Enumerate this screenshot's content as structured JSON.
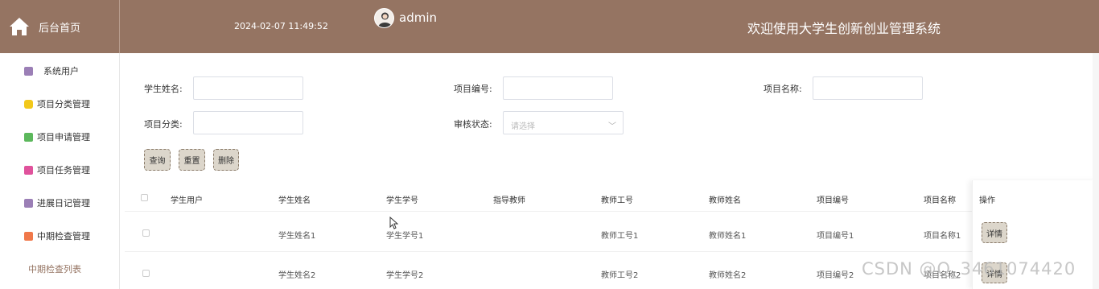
{
  "header": {
    "home_label": "后台首页",
    "datetime": "2024-02-07 11:49:52",
    "username": "admin",
    "system_title": "欢迎使用大学生创新创业管理系统"
  },
  "sidebar": {
    "items": [
      {
        "label": "系统用户",
        "icon": "user-db-icon",
        "color": "#9b7fb6"
      },
      {
        "label": "项目分类管理",
        "icon": "cube-icon",
        "color": "#f2c81b"
      },
      {
        "label": "项目申请管理",
        "icon": "message-icon",
        "color": "#5cb85c"
      },
      {
        "label": "项目任务管理",
        "icon": "task-icon",
        "color": "#e0529c"
      },
      {
        "label": "进展日记管理",
        "icon": "diary-icon",
        "color": "#9b7fb6"
      },
      {
        "label": "中期检查管理",
        "icon": "grid-icon",
        "color": "#f0784a"
      }
    ],
    "sub_item": "中期检查列表"
  },
  "search": {
    "student_name_label": "学生姓名:",
    "project_no_label": "项目编号:",
    "project_name_label": "项目名称:",
    "project_category_label": "项目分类:",
    "review_status_label": "审核状态:",
    "review_status_placeholder": "请选择"
  },
  "buttons": {
    "query": "查询",
    "reset": "重置",
    "delete": "删除"
  },
  "table": {
    "headers": [
      "学生用户",
      "学生姓名",
      "学生学号",
      "指导教师",
      "教师工号",
      "教师姓名",
      "项目编号",
      "项目名称",
      "操作"
    ],
    "rows": [
      {
        "student_user": "",
        "student_name": "学生姓名1",
        "student_no": "学生学号1",
        "advisor": "",
        "teacher_no": "教师工号1",
        "teacher_name": "教师姓名1",
        "project_no": "项目编号1",
        "project_name": "项目名称1",
        "action": "详情"
      },
      {
        "student_user": "",
        "student_name": "学生姓名2",
        "student_no": "学生学号2",
        "advisor": "",
        "teacher_no": "教师工号2",
        "teacher_name": "教师姓名2",
        "project_no": "项目编号2",
        "project_name": "项目名称2",
        "action": "详情"
      }
    ]
  },
  "watermark": "CSDN @Q_3461074420",
  "colors": {
    "header_bg": "#957462",
    "button_bg": "#dcd6cb",
    "accent": "#957462"
  }
}
